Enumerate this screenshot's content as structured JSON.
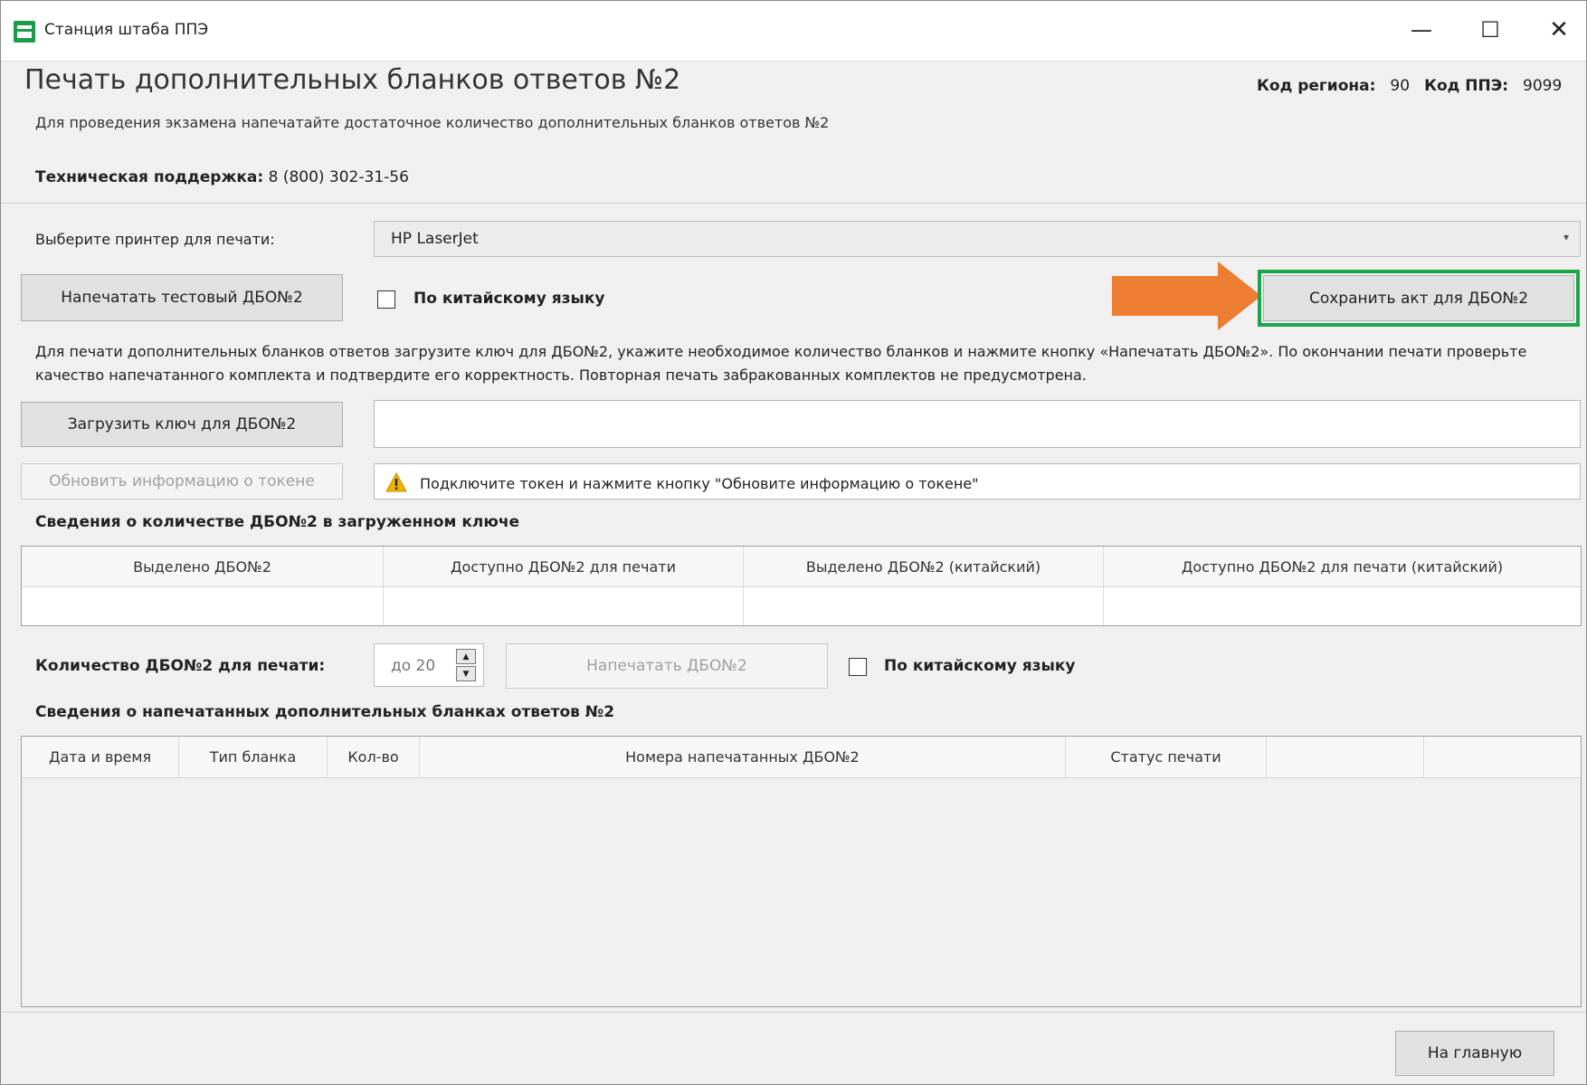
{
  "window": {
    "title": "Станция штаба ППЭ",
    "minimize": "—",
    "maximize": "☐",
    "close": "✕"
  },
  "header": {
    "title": "Печать дополнительных бланков ответов №2",
    "region_label": "Код региона:",
    "region_value": "90",
    "ppe_label": "Код ППЭ:",
    "ppe_value": "9099",
    "subtitle": "Для проведения экзамена напечатайте достаточное количество дополнительных бланков ответов №2",
    "support_label": "Техническая поддержка:",
    "support_value": "8 (800) 302-31-56"
  },
  "printer": {
    "label": "Выберите принтер для печати:",
    "value": "HP LaserJet"
  },
  "test_print": {
    "button_label": "Напечатать тестовый ДБО№2",
    "chinese_label": "По китайскому языку"
  },
  "save_act_label": "Сохранить акт для ДБО№2",
  "instructions": "Для печати дополнительных бланков ответов загрузите ключ для ДБО№2, укажите необходимое количество бланков и нажмите кнопку «Напечатать ДБО№2». По окончании печати проверьте качество напечатанного комплекта и подтвердите его корректность. Повторная печать забракованных комплектов не предусмотрена.",
  "key": {
    "load_label": "Загрузить ключ для ДБО№2",
    "path_value": ""
  },
  "token": {
    "refresh_label": "Обновить информацию о токене",
    "message": "Подключите токен и нажмите кнопку \"Обновите информацию о токене\""
  },
  "key_info": {
    "heading": "Сведения о количестве ДБО№2 в загруженном ключе",
    "columns": [
      "Выделено ДБО№2",
      "Доступно ДБО№2 для печати",
      "Выделено ДБО№2 (китайский)",
      "Доступно ДБО№2 для печати (китайский)"
    ]
  },
  "print_qty": {
    "label": "Количество ДБО№2 для печати:",
    "value": "до 20",
    "print_label": "Напечатать ДБО№2",
    "chinese_label": "По китайскому языку"
  },
  "printed": {
    "heading": "Сведения о напечатанных дополнительных бланках ответов №2",
    "columns": [
      "Дата и время",
      "Тип бланка",
      "Кол-во",
      "Номера напечатанных ДБО№2",
      "Статус печати",
      "",
      ""
    ]
  },
  "home_label": "На главную",
  "colors": {
    "highlight": "#1ea54c",
    "arrow": "#ed7d31"
  }
}
